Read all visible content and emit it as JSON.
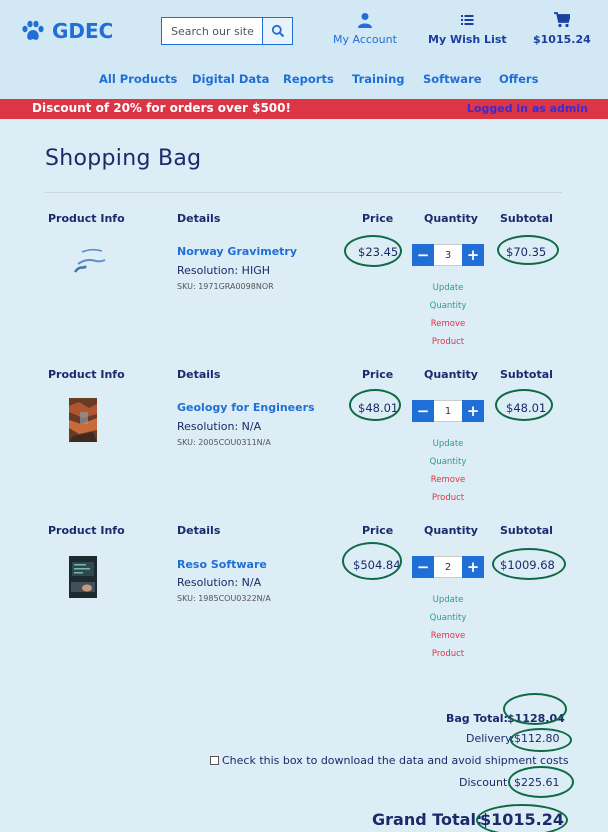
{
  "brand": {
    "name": "GDEC",
    "icon": "paw-icon"
  },
  "search": {
    "placeholder": "Search our site",
    "icon": "search-icon"
  },
  "header_links": {
    "account": {
      "label": "My Account",
      "icon": "user-icon"
    },
    "wishlist": {
      "label": "My Wish List",
      "icon": "list-icon"
    },
    "cart": {
      "label": "$1015.24",
      "icon": "cart-icon"
    }
  },
  "nav": [
    "All Products",
    "Digital Data",
    "Reports",
    "Training",
    "Software",
    "Offers"
  ],
  "banner": {
    "promo": "Discount of 20% for orders over $500!",
    "login": "Logged in as admin"
  },
  "page_title": "Shopping Bag",
  "columns": {
    "product_info": "Product Info",
    "details": "Details",
    "price": "Price",
    "quantity": "Quantity",
    "subtotal": "Subtotal"
  },
  "qty_buttons": {
    "minus": "−",
    "plus": "+"
  },
  "actions": {
    "update_1": "Update",
    "update_2": "Quantity",
    "remove_1": "Remove",
    "remove_2": "Product"
  },
  "items": [
    {
      "name": "Norway Gravimetry",
      "resolution": "Resolution: HIGH",
      "sku": "SKU: 1971GRA0098NOR",
      "price": "$23.45",
      "quantity": "3",
      "subtotal": "$70.35"
    },
    {
      "name": "Geology for Engineers",
      "resolution": "Resolution: N/A",
      "sku": "SKU: 2005COU0311N/A",
      "price": "$48.01",
      "quantity": "1",
      "subtotal": "$48.01"
    },
    {
      "name": "Reso Software",
      "resolution": "Resolution: N/A",
      "sku": "SKU: 1985COU0322N/A",
      "price": "$504.84",
      "quantity": "2",
      "subtotal": "$1009.68"
    }
  ],
  "totals": {
    "bag_label": "Bag Total:",
    "bag_value": "$1128.04",
    "delivery_label": "Delivery:",
    "delivery_value": "$112.80",
    "checkbox_label": "Check this box to download the data and avoid shipment costs",
    "discount_label": "Discount:",
    "discount_value": "$225.61",
    "grand_label": "Grand Total:",
    "grand_value": "$1015.24"
  },
  "colors": {
    "accent": "#1f6fd6",
    "banner": "#dc3545",
    "annotation": "#0f6b45"
  }
}
